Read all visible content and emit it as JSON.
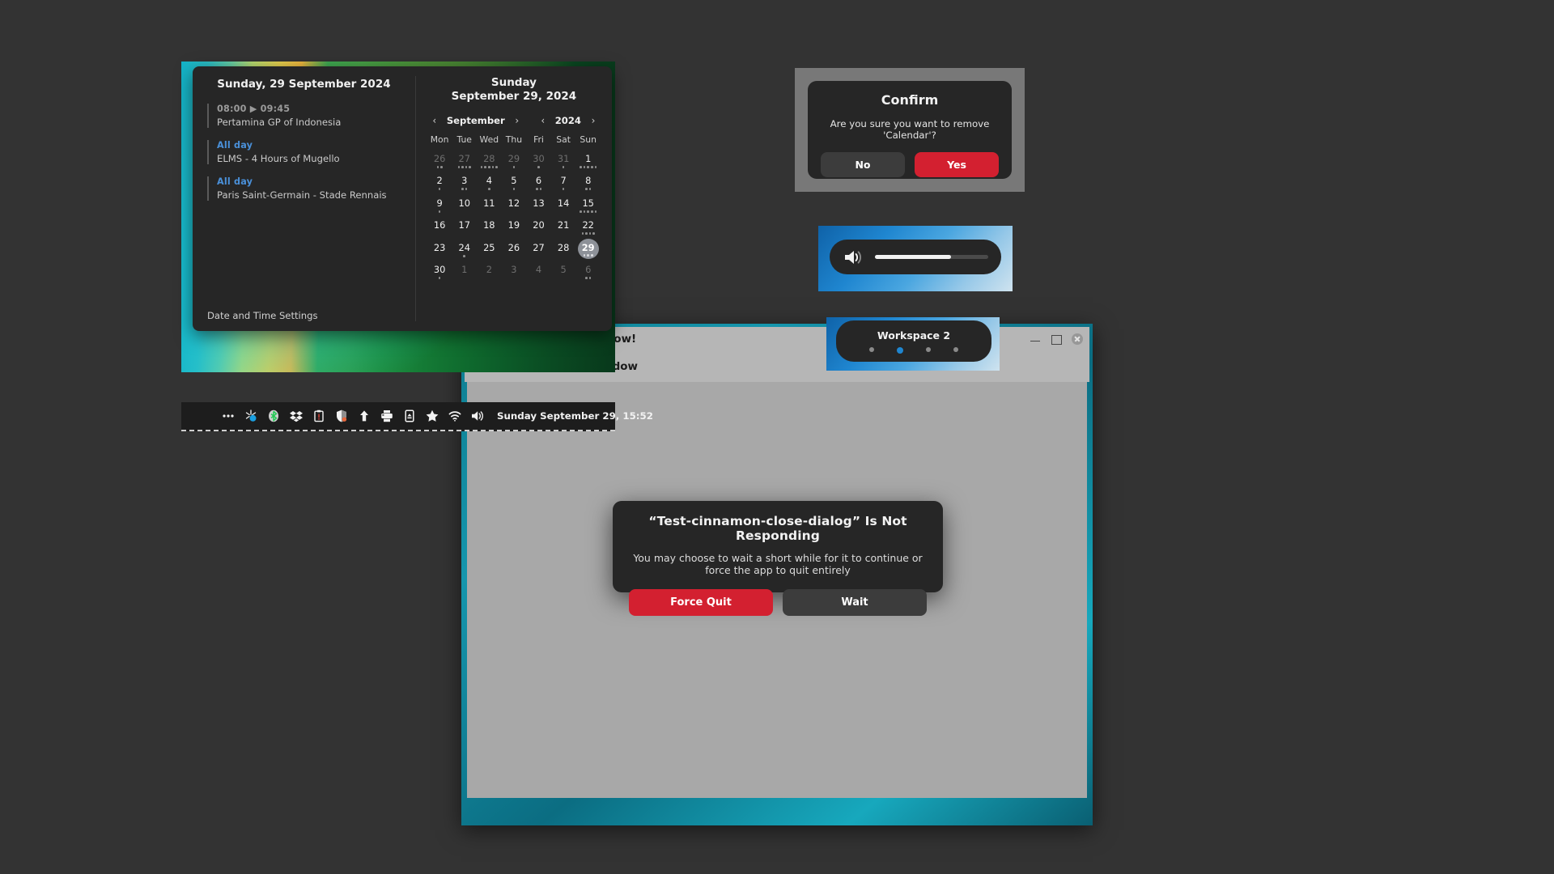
{
  "desktop": {
    "background_color": "#333333"
  },
  "test_window": {
    "title": "...ose-dialog test window!",
    "body_text": "...on to freeze the window",
    "window_buttons": [
      "minimize",
      "maximize",
      "close"
    ]
  },
  "not_responding_dialog": {
    "title": "“Test-cinnamon-close-dialog” Is Not Responding",
    "description": "You may choose to wait a short while for it to continue or force the app to quit entirely",
    "force_quit_label": "Force Quit",
    "wait_label": "Wait",
    "force_quit_color": "#d32030",
    "wait_color": "#3c3c3c"
  },
  "calendar_applet": {
    "events_title": "Sunday, 29 September 2024",
    "events": [
      {
        "time": "08:00 ▶ 09:45",
        "all_day": false,
        "name": "Pertamina GP of Indonesia"
      },
      {
        "time": "All day",
        "all_day": true,
        "name": "ELMS - 4 Hours of Mugello"
      },
      {
        "time": "All day",
        "all_day": true,
        "name": "Paris Saint-Germain - Stade Rennais"
      }
    ],
    "settings_link": "Date and Time Settings",
    "day_header_line1": "Sunday",
    "day_header_line2": "September 29, 2024",
    "month_label": "September",
    "year_label": "2024",
    "prev_month_icon": "chevron-left-icon",
    "next_month_icon": "chevron-right-icon",
    "prev_year_icon": "chevron-left-icon",
    "next_year_icon": "chevron-right-icon",
    "weekdays": [
      "Mon",
      "Tue",
      "Wed",
      "Thu",
      "Fri",
      "Sat",
      "Sun"
    ],
    "weeks": [
      [
        {
          "n": "26",
          "other": true,
          "dots": 2,
          "today": false
        },
        {
          "n": "27",
          "other": true,
          "dots": 4,
          "today": false
        },
        {
          "n": "28",
          "other": true,
          "dots": 5,
          "today": false
        },
        {
          "n": "29",
          "other": true,
          "dots": 1,
          "today": false
        },
        {
          "n": "30",
          "other": true,
          "dots": 1,
          "today": false
        },
        {
          "n": "31",
          "other": true,
          "dots": 1,
          "today": false
        },
        {
          "n": "1",
          "other": false,
          "dots": 5,
          "today": false
        }
      ],
      [
        {
          "n": "2",
          "other": false,
          "dots": 1,
          "today": false
        },
        {
          "n": "3",
          "other": false,
          "dots": 2,
          "today": false
        },
        {
          "n": "4",
          "other": false,
          "dots": 1,
          "today": false
        },
        {
          "n": "5",
          "other": false,
          "dots": 1,
          "today": false
        },
        {
          "n": "6",
          "other": false,
          "dots": 2,
          "today": false
        },
        {
          "n": "7",
          "other": false,
          "dots": 1,
          "today": false
        },
        {
          "n": "8",
          "other": false,
          "dots": 2,
          "today": false
        }
      ],
      [
        {
          "n": "9",
          "other": false,
          "dots": 1,
          "today": false
        },
        {
          "n": "10",
          "other": false,
          "dots": 0,
          "today": false
        },
        {
          "n": "11",
          "other": false,
          "dots": 0,
          "today": false
        },
        {
          "n": "12",
          "other": false,
          "dots": 0,
          "today": false
        },
        {
          "n": "13",
          "other": false,
          "dots": 0,
          "today": false
        },
        {
          "n": "14",
          "other": false,
          "dots": 0,
          "today": false
        },
        {
          "n": "15",
          "other": false,
          "dots": 5,
          "today": false
        }
      ],
      [
        {
          "n": "16",
          "other": false,
          "dots": 0,
          "today": false
        },
        {
          "n": "17",
          "other": false,
          "dots": 0,
          "today": false
        },
        {
          "n": "18",
          "other": false,
          "dots": 0,
          "today": false
        },
        {
          "n": "19",
          "other": false,
          "dots": 0,
          "today": false
        },
        {
          "n": "20",
          "other": false,
          "dots": 0,
          "today": false
        },
        {
          "n": "21",
          "other": false,
          "dots": 0,
          "today": false
        },
        {
          "n": "22",
          "other": false,
          "dots": 4,
          "today": false
        }
      ],
      [
        {
          "n": "23",
          "other": false,
          "dots": 0,
          "today": false
        },
        {
          "n": "24",
          "other": false,
          "dots": 1,
          "today": false
        },
        {
          "n": "25",
          "other": false,
          "dots": 0,
          "today": false
        },
        {
          "n": "26",
          "other": false,
          "dots": 0,
          "today": false
        },
        {
          "n": "27",
          "other": false,
          "dots": 0,
          "today": false
        },
        {
          "n": "28",
          "other": false,
          "dots": 0,
          "today": false
        },
        {
          "n": "29",
          "other": false,
          "dots": 3,
          "today": true
        }
      ],
      [
        {
          "n": "30",
          "other": false,
          "dots": 1,
          "today": false
        },
        {
          "n": "1",
          "other": true,
          "dots": 0,
          "today": false
        },
        {
          "n": "2",
          "other": true,
          "dots": 0,
          "today": false
        },
        {
          "n": "3",
          "other": true,
          "dots": 0,
          "today": false
        },
        {
          "n": "4",
          "other": true,
          "dots": 0,
          "today": false
        },
        {
          "n": "5",
          "other": true,
          "dots": 0,
          "today": false
        },
        {
          "n": "6",
          "other": true,
          "dots": 2,
          "today": false
        }
      ]
    ]
  },
  "panel": {
    "tray_icons": [
      "overflow-menu-icon",
      "network-manager-icon",
      "bluetooth-icon",
      "dropbox-icon",
      "clipboard-icon",
      "shield-icon",
      "updates-icon",
      "printer-icon",
      "removable-media-icon",
      "favorites-star-icon",
      "wifi-icon",
      "volume-icon"
    ],
    "clock": "Sunday September 29, 15:52"
  },
  "confirm_dialog": {
    "title": "Confirm",
    "message": "Are you sure you want to remove 'Calendar'?",
    "no_label": "No",
    "yes_label": "Yes",
    "yes_color": "#d32030",
    "no_color": "#3c3c3c"
  },
  "volume_osd": {
    "icon": "volume-high-icon",
    "level_percent": 67
  },
  "workspace_osd": {
    "label": "Workspace 2",
    "total_workspaces": 4,
    "active_index": 2,
    "active_color": "#1f86d0"
  }
}
